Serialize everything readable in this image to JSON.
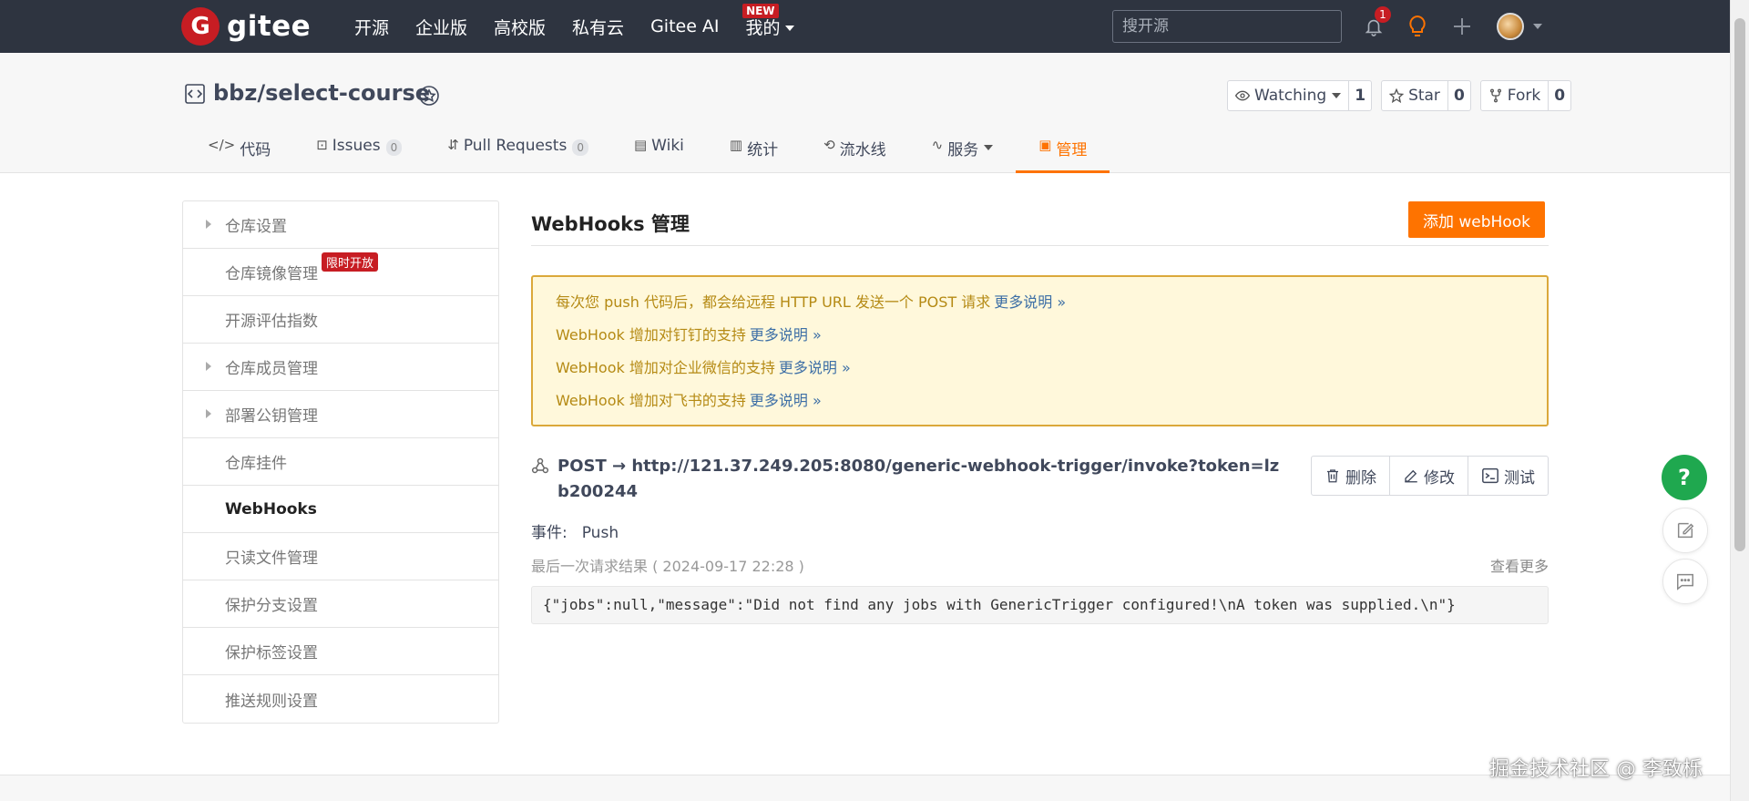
{
  "topbar": {
    "logo_mark": "G",
    "logo_text": "gitee",
    "nav": [
      "开源",
      "企业版",
      "高校版",
      "私有云",
      "Gitee AI",
      "我的"
    ],
    "nav_new_badge": "NEW",
    "search_placeholder": "搜开源",
    "notification_count": "1",
    "icons": [
      "bell-icon",
      "bulb-icon",
      "plus-icon",
      "avatar"
    ]
  },
  "repo": {
    "title": "bbz/select-course",
    "watch_label": "Watching",
    "watch_count": "1",
    "star_label": "Star",
    "star_count": "0",
    "fork_label": "Fork",
    "fork_count": "0"
  },
  "tabs": [
    {
      "icon": "</>",
      "label": "代码"
    },
    {
      "icon": "⊡",
      "label": "Issues",
      "count": "0"
    },
    {
      "icon": "⇵",
      "label": "Pull Requests",
      "count": "0"
    },
    {
      "icon": "▤",
      "label": "Wiki"
    },
    {
      "icon": "▥",
      "label": "统计"
    },
    {
      "icon": "⟲",
      "label": "流水线"
    },
    {
      "icon": "∿",
      "label": "服务"
    },
    {
      "icon": "▣",
      "label": "管理"
    }
  ],
  "sidebar": {
    "items": [
      {
        "label": "仓库设置",
        "arrow": true
      },
      {
        "label": "仓库镜像管理",
        "badge": "限时开放"
      },
      {
        "label": "开源评估指数"
      },
      {
        "label": "仓库成员管理",
        "arrow": true
      },
      {
        "label": "部署公钥管理",
        "arrow": true
      },
      {
        "label": "仓库挂件"
      },
      {
        "label": "WebHooks",
        "active": true
      },
      {
        "label": "只读文件管理"
      },
      {
        "label": "保护分支设置"
      },
      {
        "label": "保护标签设置"
      },
      {
        "label": "推送规则设置"
      }
    ]
  },
  "content": {
    "title": "WebHooks 管理",
    "add_button": "添加 webHook",
    "notices": [
      {
        "text": "每次您 push 代码后，都会给远程 HTTP URL 发送一个 POST 请求",
        "link": "更多说明 »"
      },
      {
        "text": "WebHook 增加对钉钉的支持",
        "link": "更多说明 »"
      },
      {
        "text": "WebHook 增加对企业微信的支持",
        "link": "更多说明 »"
      },
      {
        "text": "WebHook 增加对飞书的支持",
        "link": "更多说明 »"
      }
    ],
    "hook": {
      "url": "POST → http://121.37.249.205:8080/generic-webhook-trigger/invoke?token=lzb200244",
      "delete_label": "删除",
      "edit_label": "修改",
      "test_label": "测试",
      "event_label": "事件:",
      "event_value": "Push",
      "last_result": "最后一次请求结果 ( 2024-09-17 22:28 )",
      "more_label": "查看更多",
      "result_json": "{\"jobs\":null,\"message\":\"Did not find any jobs with GenericTrigger configured!\\nA token was supplied.\\n\"}"
    }
  },
  "floating": {
    "help": "?"
  },
  "watermark": "掘金技术社区 @ 李致栎",
  "colors": {
    "brand_red": "#c71d23",
    "accent_orange": "#fe7300",
    "help_green": "#1fa84f",
    "nav_bg": "#2e3440"
  }
}
